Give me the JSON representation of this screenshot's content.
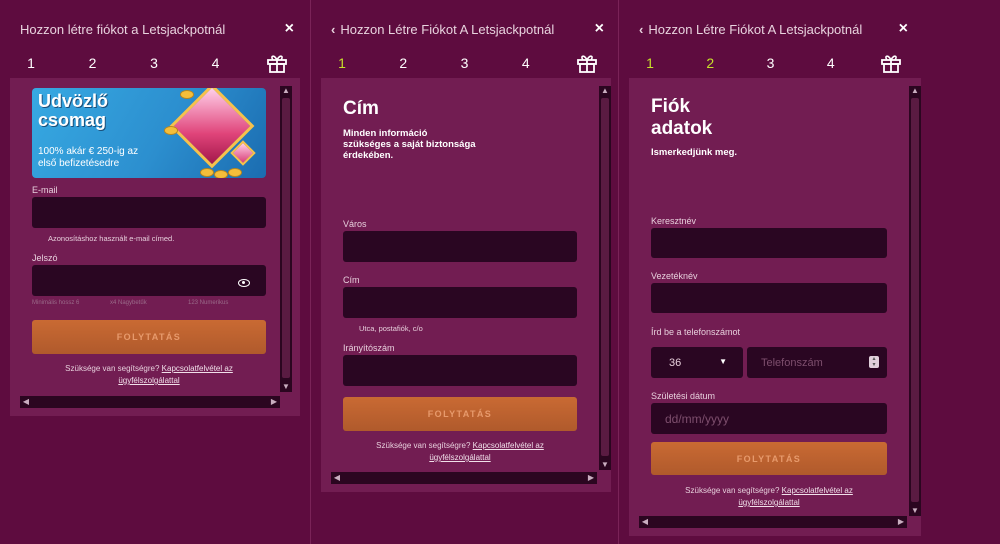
{
  "panel1": {
    "title": "Hozzon létre fiókot a Letsjackpotnál",
    "close": "×",
    "steps": [
      "1",
      "2",
      "3",
      "4"
    ],
    "banner": {
      "heading": "Udvözlő csomag",
      "text": "100% akár € 250-ig az első befizetésedre"
    },
    "email_label": "E-mail",
    "email_hint": "Azonosításhoz használt e-mail címed.",
    "password_label": "Jelszó",
    "password_rules": [
      "Minimális hossz 6",
      "x4 Nagybetűk",
      "123 Numerikus"
    ],
    "continue": "FOLYTATÁS",
    "help_text": "Szüksége van segítségre?",
    "help_link_1": "Kapcsolatfelvétel az",
    "help_link_2": "ügyfélszolgálattal"
  },
  "panel2": {
    "title": "Hozzon Létre Fiókot A Letsjackpotnál",
    "close": "×",
    "steps": [
      "1",
      "2",
      "3",
      "4"
    ],
    "heading": "Cím",
    "subheading": [
      "Minden információ",
      "szükséges a saját biztonsága",
      "érdekében."
    ],
    "city_label": "Város",
    "address_label": "Cím",
    "address_hint": "Utca, postafiók, c/o",
    "zip_label": "Irányítószám",
    "continue": "FOLYTATÁS",
    "help_text": "Szüksége van segítségre?",
    "help_link_1": "Kapcsolatfelvétel az",
    "help_link_2": "ügyfélszolgálattal"
  },
  "panel3": {
    "title": "Hozzon Létre Fiókot A Letsjackpotnál",
    "close": "×",
    "steps": [
      "1",
      "2",
      "3",
      "4"
    ],
    "heading": [
      "Fiók",
      "adatok"
    ],
    "subheading": "Ismerkedjünk meg.",
    "firstname_label": "Keresztnév",
    "lastname_label": "Vezetéknév",
    "phone_label": "Írd be a telefonszámot",
    "country_code": "36",
    "phone_placeholder": "Telefonszám",
    "dob_label": "Születési dátum",
    "dob_placeholder": "dd/mm/yyyy",
    "continue": "FOLYTATÁS",
    "help_text": "Szüksége van segítségre?",
    "help_link_1": "Kapcsolatfelvétel az",
    "help_link_2": "ügyfélszolgálattal"
  },
  "colors": {
    "background": "#5e0c3f",
    "panel": "#721d52",
    "input": "#2a0622",
    "button": "#c96a33",
    "step_done": "#c7e02a"
  }
}
